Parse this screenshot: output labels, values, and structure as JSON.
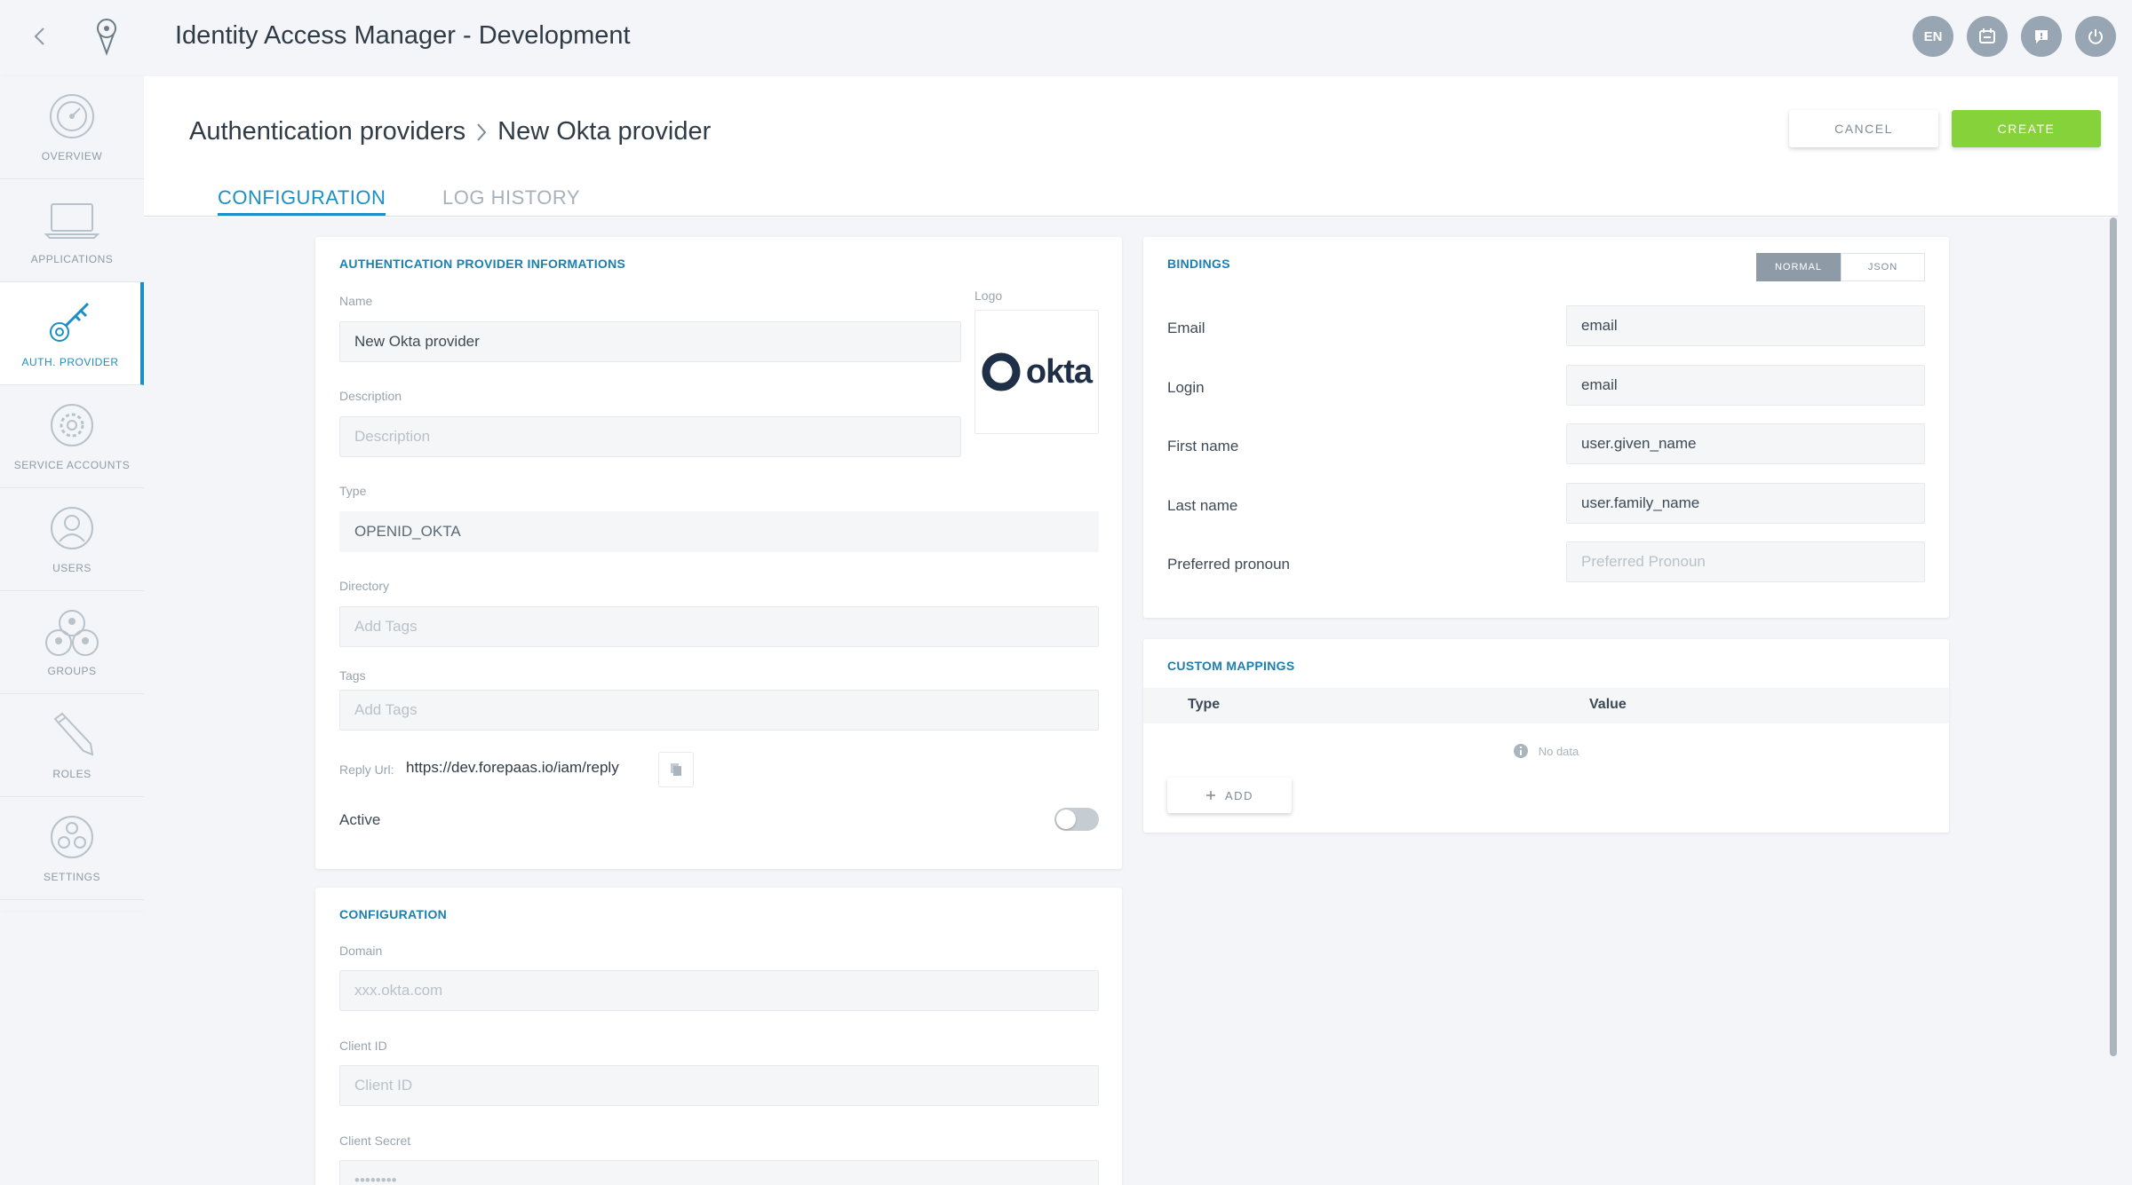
{
  "app": {
    "title": "Identity Access Manager - Development"
  },
  "topbar": {
    "lang": "EN"
  },
  "sidebar": {
    "items": [
      {
        "label": "OVERVIEW",
        "icon": "dashboard-icon"
      },
      {
        "label": "APPLICATIONS",
        "icon": "laptop-icon"
      },
      {
        "label": "AUTH. PROVIDER",
        "icon": "key-icon",
        "active": true
      },
      {
        "label": "SERVICE ACCOUNTS",
        "icon": "gear-icon"
      },
      {
        "label": "USERS",
        "icon": "user-icon"
      },
      {
        "label": "GROUPS",
        "icon": "group-icon"
      },
      {
        "label": "ROLES",
        "icon": "pencil-icon"
      },
      {
        "label": "SETTINGS",
        "icon": "settings-icon"
      }
    ]
  },
  "breadcrumb": {
    "parent": "Authentication providers",
    "current": "New Okta provider"
  },
  "actions": {
    "cancel": "CANCEL",
    "create": "CREATE"
  },
  "tabs": [
    {
      "label": "CONFIGURATION",
      "active": true
    },
    {
      "label": "LOG HISTORY"
    }
  ],
  "provider_info": {
    "title": "AUTHENTICATION PROVIDER INFORMATIONS",
    "name_label": "Name",
    "name_value": "New Okta provider",
    "logo_label": "Logo",
    "logo_text": "okta",
    "description_label": "Description",
    "description_placeholder": "Description",
    "type_label": "Type",
    "type_value": "OPENID_OKTA",
    "directory_label": "Directory",
    "directory_placeholder": "Add Tags",
    "tags_label": "Tags",
    "tags_placeholder": "Add Tags",
    "reply_url_label": "Reply Url:",
    "reply_url_value": "https://dev.forepaas.io/iam/reply",
    "active_label": "Active",
    "active": false
  },
  "configuration": {
    "title": "CONFIGURATION",
    "domain_label": "Domain",
    "domain_placeholder": "xxx.okta.com",
    "client_id_label": "Client ID",
    "client_id_placeholder": "Client ID",
    "client_secret_label": "Client Secret",
    "client_secret_placeholder": "••••••••"
  },
  "bindings": {
    "title": "BINDINGS",
    "mode_normal": "NORMAL",
    "mode_json": "JSON",
    "rows": [
      {
        "label": "Email",
        "value": "email",
        "placeholder": ""
      },
      {
        "label": "Login",
        "value": "email",
        "placeholder": ""
      },
      {
        "label": "First name",
        "value": "user.given_name",
        "placeholder": ""
      },
      {
        "label": "Last name",
        "value": "user.family_name",
        "placeholder": ""
      },
      {
        "label": "Preferred pronoun",
        "value": "",
        "placeholder": "Preferred Pronoun"
      }
    ]
  },
  "custom_mappings": {
    "title": "CUSTOM MAPPINGS",
    "col_type": "Type",
    "col_value": "Value",
    "empty": "No data",
    "add": "ADD"
  },
  "colors": {
    "accent": "#1b8fc4",
    "create": "#86d23a",
    "okta": "#1f2f47"
  }
}
